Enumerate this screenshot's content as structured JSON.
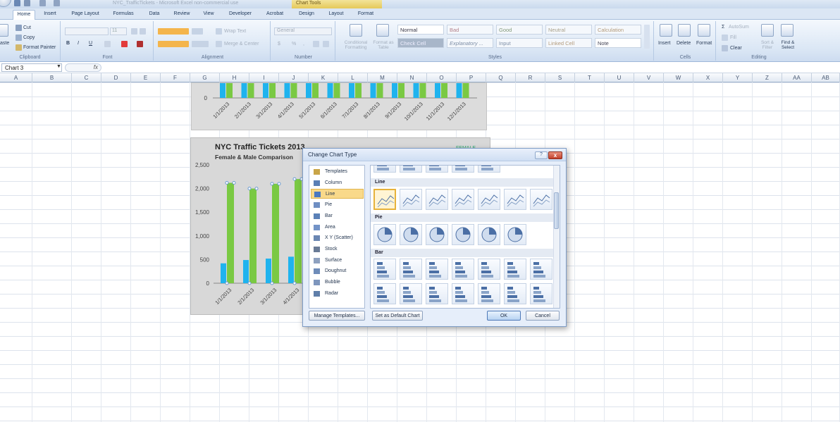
{
  "titlebar": {
    "title": "NYC_TrafficTickets - Microsoft Excel non-commercial use",
    "context": "Chart Tools"
  },
  "tabs": [
    "Home",
    "Insert",
    "Page Layout",
    "Formulas",
    "Data",
    "Review",
    "View",
    "Developer",
    "Acrobat",
    "Design",
    "Layout",
    "Format"
  ],
  "ribbon": {
    "clipboard": {
      "label": "Clipboard",
      "paste": "aste",
      "cut": "Cut",
      "copy": "Copy",
      "painter": "Format Painter"
    },
    "font": {
      "label": "Font",
      "size": "11"
    },
    "alignment": {
      "label": "Alignment",
      "wrap": "Wrap Text",
      "merge": "Merge & Center"
    },
    "number": {
      "label": "Number",
      "format": "General"
    },
    "styles": {
      "label": "Styles",
      "conditional": "Conditional Formatting",
      "table": "Format as Table",
      "cells": [
        "Normal",
        "Bad",
        "Good",
        "Neutral",
        "Calculation",
        "Check Cell",
        "Explanatory ...",
        "Input",
        "Linked Cell",
        "Note"
      ]
    },
    "cells": {
      "label": "Cells",
      "insert": "Insert",
      "delete": "Delete",
      "format": "Format"
    },
    "editing": {
      "label": "Editing",
      "autosum": "AutoSum",
      "fill": "Fill",
      "clear": "Clear",
      "sort": "Sort & Filter",
      "find": "Find & Select"
    }
  },
  "formula": {
    "namebox": "Chart 3",
    "fx": "fx"
  },
  "columns": [
    "A",
    "B",
    "C",
    "D",
    "E",
    "F",
    "G",
    "H",
    "I",
    "J",
    "K",
    "L",
    "M",
    "N",
    "O",
    "P",
    "Q",
    "R",
    "S",
    "T",
    "U",
    "V",
    "W",
    "X",
    "Y",
    "Z",
    "AA",
    "AB"
  ],
  "chart": {
    "title": "NYC Traffic Tickets 2013",
    "subtitle": "Female & Male Comparison",
    "legend_hint": "FEMALE",
    "top_axis_zero": "0",
    "top_dates": [
      "1/1/2013",
      "2/1/2013",
      "3/1/2013",
      "4/1/2013",
      "5/1/2013",
      "6/1/2013",
      "7/1/2013",
      "8/1/2013",
      "9/1/2013",
      "10/1/2013",
      "11/1/2013",
      "12/1/2013"
    ],
    "colors": {
      "female": "#1fb3ee",
      "male": "#7ac943"
    }
  },
  "chart_data": {
    "type": "bar",
    "title": "NYC Traffic Tickets 2013",
    "subtitle": "Female & Male Comparison",
    "categories": [
      "1/1/2013",
      "2/1/2013",
      "3/1/2013",
      "4/1/2013"
    ],
    "series": [
      {
        "values": [
          420,
          490,
          520,
          560
        ]
      },
      {
        "values": [
          2120,
          2000,
          2100,
          2200
        ]
      }
    ],
    "yticks": [
      "0",
      "500",
      "1,000",
      "1,500",
      "2,000",
      "2,500"
    ],
    "ylim": [
      0,
      2500
    ],
    "grid": false
  },
  "dialog": {
    "title": "Change Chart Type",
    "help": "?",
    "close": "x",
    "categories": [
      "Templates",
      "Column",
      "Line",
      "Pie",
      "Bar",
      "Area",
      "X Y (Scatter)",
      "Stock",
      "Surface",
      "Doughnut",
      "Bubble",
      "Radar"
    ],
    "selected": "Line",
    "sections": [
      "Line",
      "Pie",
      "Bar"
    ],
    "manage": "Manage Templates...",
    "setdefault": "Set as Default Chart",
    "ok": "OK",
    "cancel": "Cancel"
  }
}
